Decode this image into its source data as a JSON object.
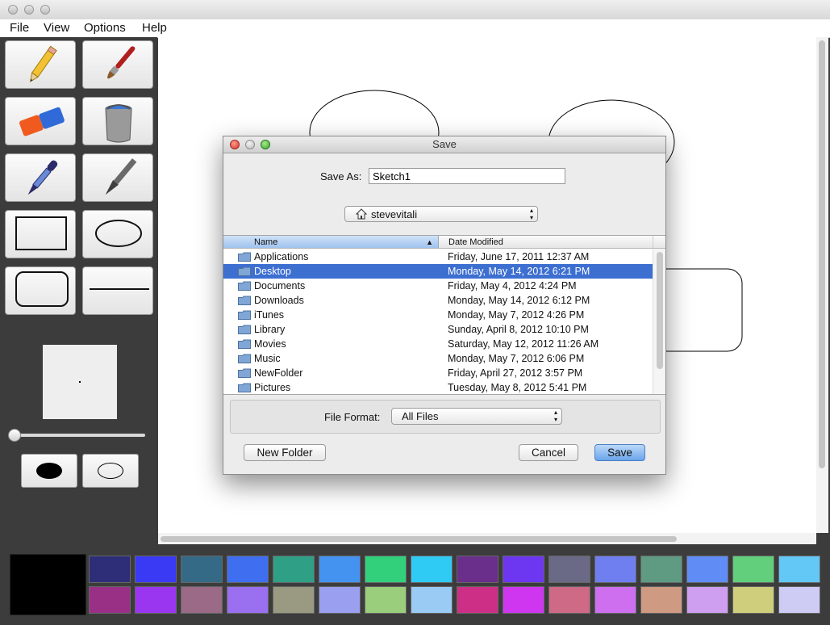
{
  "window": {
    "title": ""
  },
  "menubar": {
    "items": [
      "File",
      "View",
      "Options",
      "Help"
    ]
  },
  "tools": [
    {
      "name": "pencil-tool",
      "icon": "pencil-icon"
    },
    {
      "name": "brush-tool",
      "icon": "paintbrush-icon"
    },
    {
      "name": "eraser-tool",
      "icon": "eraser-icon"
    },
    {
      "name": "fill-tool",
      "icon": "paint-bucket-icon"
    },
    {
      "name": "eyedropper-tool",
      "icon": "eyedropper-icon"
    },
    {
      "name": "pen-tool",
      "icon": "pen-icon"
    },
    {
      "name": "rectangle-tool",
      "icon": "rectangle-icon"
    },
    {
      "name": "ellipse-tool",
      "icon": "ellipse-icon"
    },
    {
      "name": "rounded-rect-tool",
      "icon": "rounded-rectangle-icon"
    },
    {
      "name": "line-tool",
      "icon": "line-icon"
    }
  ],
  "brush": {
    "size_slider_value": 0,
    "fill_modes": [
      "filled",
      "outline"
    ]
  },
  "palette": {
    "current_color": "#000000",
    "row1": [
      "#2e2e78",
      "#3a3af5",
      "#356a86",
      "#3f6ff0",
      "#2f9f86",
      "#4493f0",
      "#33d07c",
      "#30cbf5",
      "#6a2f8a",
      "#6d36f0",
      "#6a6a86",
      "#6f7ff0",
      "#5f9a82",
      "#5f8cf5",
      "#62cf7c",
      "#63c8f5"
    ],
    "row2": [
      "#9a2f86",
      "#9a36f0",
      "#9a6a86",
      "#9a6ff0",
      "#9a9a82",
      "#9a9ff0",
      "#9ace7c",
      "#9acbf5",
      "#ce2f86",
      "#ce36f0",
      "#ce6a86",
      "#ce6ff0",
      "#ce9a82",
      "#ce9ff0",
      "#cece7c",
      "#cecbf5"
    ]
  },
  "dialog": {
    "title": "Save",
    "save_as_label": "Save As:",
    "save_as_value": "Sketch1",
    "location": "stevevitali",
    "columns": {
      "name": "Name",
      "date": "Date Modified"
    },
    "files": [
      {
        "name": "Applications",
        "date": "Friday, June 17, 2011 12:37 AM",
        "selected": false
      },
      {
        "name": "Desktop",
        "date": "Monday, May 14, 2012 6:21 PM",
        "selected": true
      },
      {
        "name": "Documents",
        "date": "Friday, May 4, 2012 4:24 PM",
        "selected": false
      },
      {
        "name": "Downloads",
        "date": "Monday, May 14, 2012 6:12 PM",
        "selected": false
      },
      {
        "name": "iTunes",
        "date": "Monday, May 7, 2012 4:26 PM",
        "selected": false
      },
      {
        "name": "Library",
        "date": "Sunday, April 8, 2012 10:10 PM",
        "selected": false
      },
      {
        "name": "Movies",
        "date": "Saturday, May 12, 2012 11:26 AM",
        "selected": false
      },
      {
        "name": "Music",
        "date": "Monday, May 7, 2012 6:06 PM",
        "selected": false
      },
      {
        "name": "NewFolder",
        "date": "Friday, April 27, 2012 3:57 PM",
        "selected": false
      },
      {
        "name": "Pictures",
        "date": "Tuesday, May 8, 2012 5:41 PM",
        "selected": false
      }
    ],
    "file_format_label": "File Format:",
    "file_format_value": "All Files",
    "new_folder_label": "New Folder",
    "cancel_label": "Cancel",
    "save_label": "Save"
  }
}
